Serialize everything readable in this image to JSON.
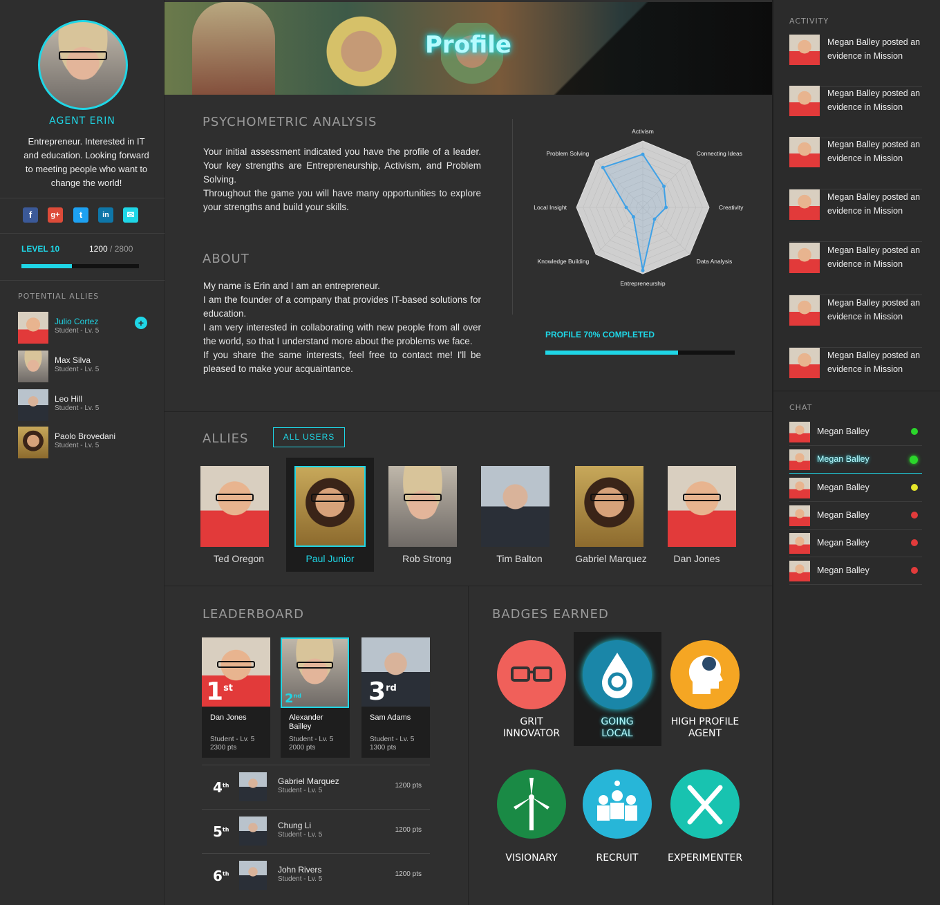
{
  "profile": {
    "name": "AGENT ERIN",
    "bio": "Entrepreneur. Interested in IT and education. Looking forward to meeting people who want to change the world!",
    "social": [
      "facebook-icon",
      "google-plus-icon",
      "twitter-icon",
      "linkedin-icon",
      "email-icon"
    ],
    "level_label": "LEVEL 10",
    "xp_current": "1200",
    "xp_max": "/ 2800",
    "xp_fraction": 0.43
  },
  "potential_allies": {
    "title": "POTENTIAL ALLIES",
    "items": [
      {
        "name": "Julio Cortez",
        "sub": "Student - Lv. 5"
      },
      {
        "name": "Max Silva",
        "sub": "Student - Lv. 5"
      },
      {
        "name": "Leo Hill",
        "sub": "Student - Lv. 5"
      },
      {
        "name": "Paolo Brovedani",
        "sub": "Student - Lv. 5"
      }
    ]
  },
  "banner": {
    "title": "Profile"
  },
  "psychometric": {
    "title": "PSYCHOMETRIC ANALYSIS",
    "text": "Your initial assessment indicated you have the profile of a leader. Your key strengths are Entrepreneurship, Activism, and Problem Solving.",
    "text2": "Throughout the game you will have many opportunities to explore your strengths and build your skills."
  },
  "about": {
    "title": "ABOUT",
    "lines": [
      "My name is Erin and I am an entrepreneur.",
      "I am the founder of a company that provides IT-based solutions for education.",
      "I am very interested in collaborating with new people from all over the world, so that I understand more about the problems we face.",
      "If you share the same interests, feel free to contact me! I'll be pleased to make your acquaintance."
    ]
  },
  "chart_data": {
    "type": "radar",
    "categories": [
      "Activism",
      "Connecting Ideas",
      "Creativity",
      "Data Analysis",
      "Entrepreneurship",
      "Knowledge Building",
      "Local Insight",
      "Problem Solving"
    ],
    "values": [
      0.8,
      0.45,
      0.35,
      0.25,
      0.95,
      0.2,
      0.25,
      0.85
    ],
    "max": 1,
    "rings": 10
  },
  "profile_completion": {
    "label": "PROFILE 70% COMPLETED",
    "fraction": 0.7
  },
  "allies": {
    "title": "ALLIES",
    "all_users_label": "ALL USERS",
    "items": [
      {
        "name": "Ted Oregon"
      },
      {
        "name": "Paul Junior"
      },
      {
        "name": "Rob Strong"
      },
      {
        "name": "Tim Balton"
      },
      {
        "name": "Gabriel Marquez"
      },
      {
        "name": "Dan Jones"
      }
    ]
  },
  "leaderboard": {
    "title": "LEADERBOARD",
    "top": [
      {
        "rank": "1",
        "suffix": "st",
        "name": "Dan Jones",
        "sub": "Student - Lv. 5",
        "pts": "2300 pts"
      },
      {
        "rank": "2",
        "suffix": "nd",
        "name": "Alexander Bailley",
        "sub": "Student - Lv. 5",
        "pts": "2000 pts"
      },
      {
        "rank": "3",
        "suffix": "rd",
        "name": "Sam Adams",
        "sub": "Student - Lv. 5",
        "pts": "1300 pts"
      }
    ],
    "rows": [
      {
        "rank": "4",
        "suffix": "th",
        "name": "Gabriel Marquez",
        "sub": "Student - Lv. 5",
        "pts": "1200 pts"
      },
      {
        "rank": "5",
        "suffix": "th",
        "name": "Chung Li",
        "sub": "Student - Lv. 5",
        "pts": "1200 pts"
      },
      {
        "rank": "6",
        "suffix": "th",
        "name": "John Rivers",
        "sub": "Student - Lv. 5",
        "pts": "1200 pts"
      }
    ]
  },
  "badges": {
    "title": "BADGES EARNED",
    "items": [
      {
        "label1": "GRIT",
        "label2": "INNOVATOR",
        "color": "#f0605a",
        "icon": "glasses-icon"
      },
      {
        "label1": "GOING",
        "label2": "LOCAL",
        "color": "#1a86a8",
        "icon": "water-drop-icon"
      },
      {
        "label1": "HIGH PROFILE",
        "label2": "AGENT",
        "color": "#f5a623",
        "icon": "head-idea-icon"
      },
      {
        "label1": "VISIONARY",
        "label2": "",
        "color": "#1a8a45",
        "icon": "wind-turbine-icon"
      },
      {
        "label1": "RECRUIT",
        "label2": "",
        "color": "#27b6d8",
        "icon": "group-icon"
      },
      {
        "label1": "EXPERIMENTER",
        "label2": "",
        "color": "#18c3b0",
        "icon": "fork-knife-icon"
      }
    ]
  },
  "activity": {
    "title": "ACTIVITY",
    "items": [
      {
        "line1": "Megan Balley posted an",
        "line2": "evidence in Mission"
      },
      {
        "line1": "Megan Balley posted an",
        "line2": "evidence in Mission"
      },
      {
        "line1": "Megan Balley posted an",
        "line2": "evidence in Mission"
      },
      {
        "line1": "Megan Balley posted an",
        "line2": "evidence in Mission"
      },
      {
        "line1": "Megan Balley posted an",
        "line2": "evidence in Mission"
      },
      {
        "line1": "Megan Balley posted an",
        "line2": "evidence in Mission"
      },
      {
        "line1": "Megan Balley posted an",
        "line2": "evidence in Mission"
      }
    ]
  },
  "chat": {
    "title": "CHAT",
    "items": [
      {
        "name": "Megan Balley",
        "status": "#2bd62b"
      },
      {
        "name": "Megan Balley",
        "status": "#2bd62b"
      },
      {
        "name": "Megan Balley",
        "status": "#e6e62a"
      },
      {
        "name": "Megan Balley",
        "status": "#e23b3b"
      },
      {
        "name": "Megan Balley",
        "status": "#e23b3b"
      },
      {
        "name": "Megan Balley",
        "status": "#e23b3b"
      }
    ]
  }
}
